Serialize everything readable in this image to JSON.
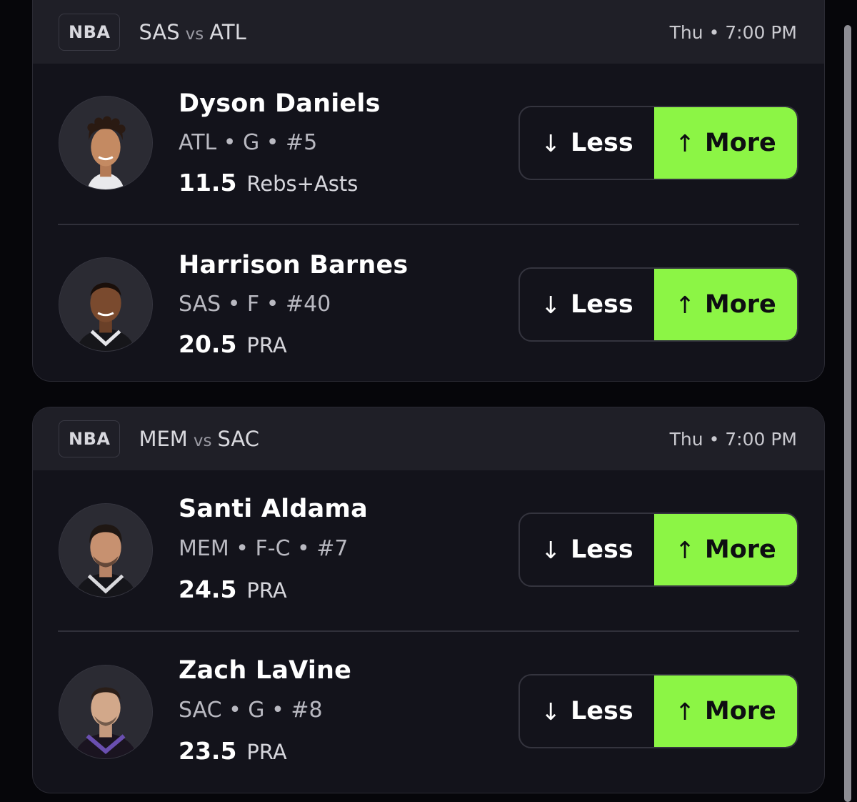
{
  "colors": {
    "background": "#06060a",
    "card": "#13131b",
    "header": "#1f1f27",
    "more_button": "#8cf545"
  },
  "games": [
    {
      "league": "NBA",
      "home": "SAS",
      "vs": "vs",
      "away": "ATL",
      "time": "Thu • 7:00 PM",
      "players": [
        {
          "name": "Dyson Daniels",
          "meta": "ATL • G • #5",
          "line": "11.5",
          "stat": "Rebs+Asts",
          "less_label": "Less",
          "more_label": "More",
          "less_icon": "arrow-down-icon",
          "more_icon": "arrow-up-icon"
        },
        {
          "name": "Harrison Barnes",
          "meta": "SAS • F • #40",
          "line": "20.5",
          "stat": "PRA",
          "less_label": "Less",
          "more_label": "More",
          "less_icon": "arrow-down-icon",
          "more_icon": "arrow-up-icon"
        }
      ]
    },
    {
      "league": "NBA",
      "home": "MEM",
      "vs": "vs",
      "away": "SAC",
      "time": "Thu • 7:00 PM",
      "players": [
        {
          "name": "Santi Aldama",
          "meta": "MEM • F-C • #7",
          "line": "24.5",
          "stat": "PRA",
          "less_label": "Less",
          "more_label": "More",
          "less_icon": "arrow-down-icon",
          "more_icon": "arrow-up-icon"
        },
        {
          "name": "Zach LaVine",
          "meta": "SAC • G • #8",
          "line": "23.5",
          "stat": "PRA",
          "less_label": "Less",
          "more_label": "More",
          "less_icon": "arrow-down-icon",
          "more_icon": "arrow-up-icon"
        }
      ]
    }
  ]
}
